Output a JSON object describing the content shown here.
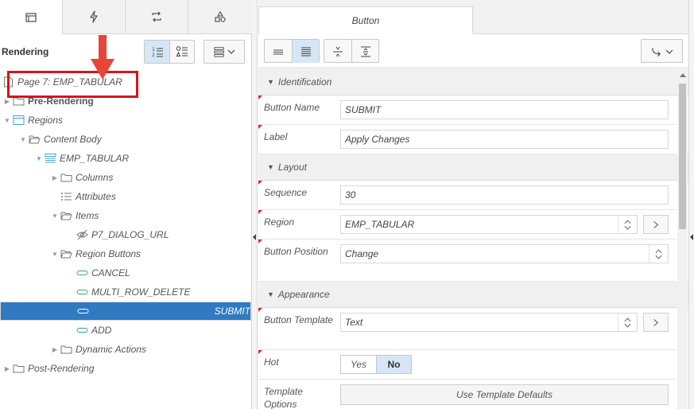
{
  "left": {
    "tabs": [
      {
        "icon": "rendering-tab-icon",
        "active": true
      },
      {
        "icon": "dynamic-actions-icon"
      },
      {
        "icon": "processing-icon"
      },
      {
        "icon": "shared-components-icon"
      }
    ],
    "title": "Rendering",
    "tree": {
      "page": "Page 7: EMP_TABULAR",
      "pre_rendering": "Pre-Rendering",
      "regions": "Regions",
      "content_body": "Content Body",
      "emp_tabular": "EMP_TABULAR",
      "columns": "Columns",
      "attributes": "Attributes",
      "items": "Items",
      "p7_dialog_url": "P7_DIALOG_URL",
      "region_buttons": "Region Buttons",
      "cancel": "CANCEL",
      "multi_row_delete": "MULTI_ROW_DELETE",
      "submit": "SUBMIT",
      "add": "ADD",
      "dynamic_actions": "Dynamic Actions",
      "post_rendering": "Post-Rendering"
    }
  },
  "right": {
    "tab": "Button",
    "sections": {
      "identification": "Identification",
      "layout": "Layout",
      "appearance": "Appearance"
    },
    "props": {
      "button_name_label": "Button Name",
      "button_name": "SUBMIT",
      "label_label": "Label",
      "label": "Apply Changes",
      "sequence_label": "Sequence",
      "sequence": "30",
      "region_label": "Region",
      "region": "EMP_TABULAR",
      "button_position_label": "Button Position",
      "button_position": "Change",
      "button_template_label": "Button Template",
      "button_template": "Text",
      "hot_label": "Hot",
      "hot_yes": "Yes",
      "hot_no": "No",
      "template_options_label": "Template Options",
      "template_defaults": "Use Template Defaults"
    }
  },
  "colors": {
    "selection": "#2f7ac1",
    "highlight": "#d6151a",
    "arrow": "#e8453a",
    "toggle_on": "#d6e6f6"
  }
}
